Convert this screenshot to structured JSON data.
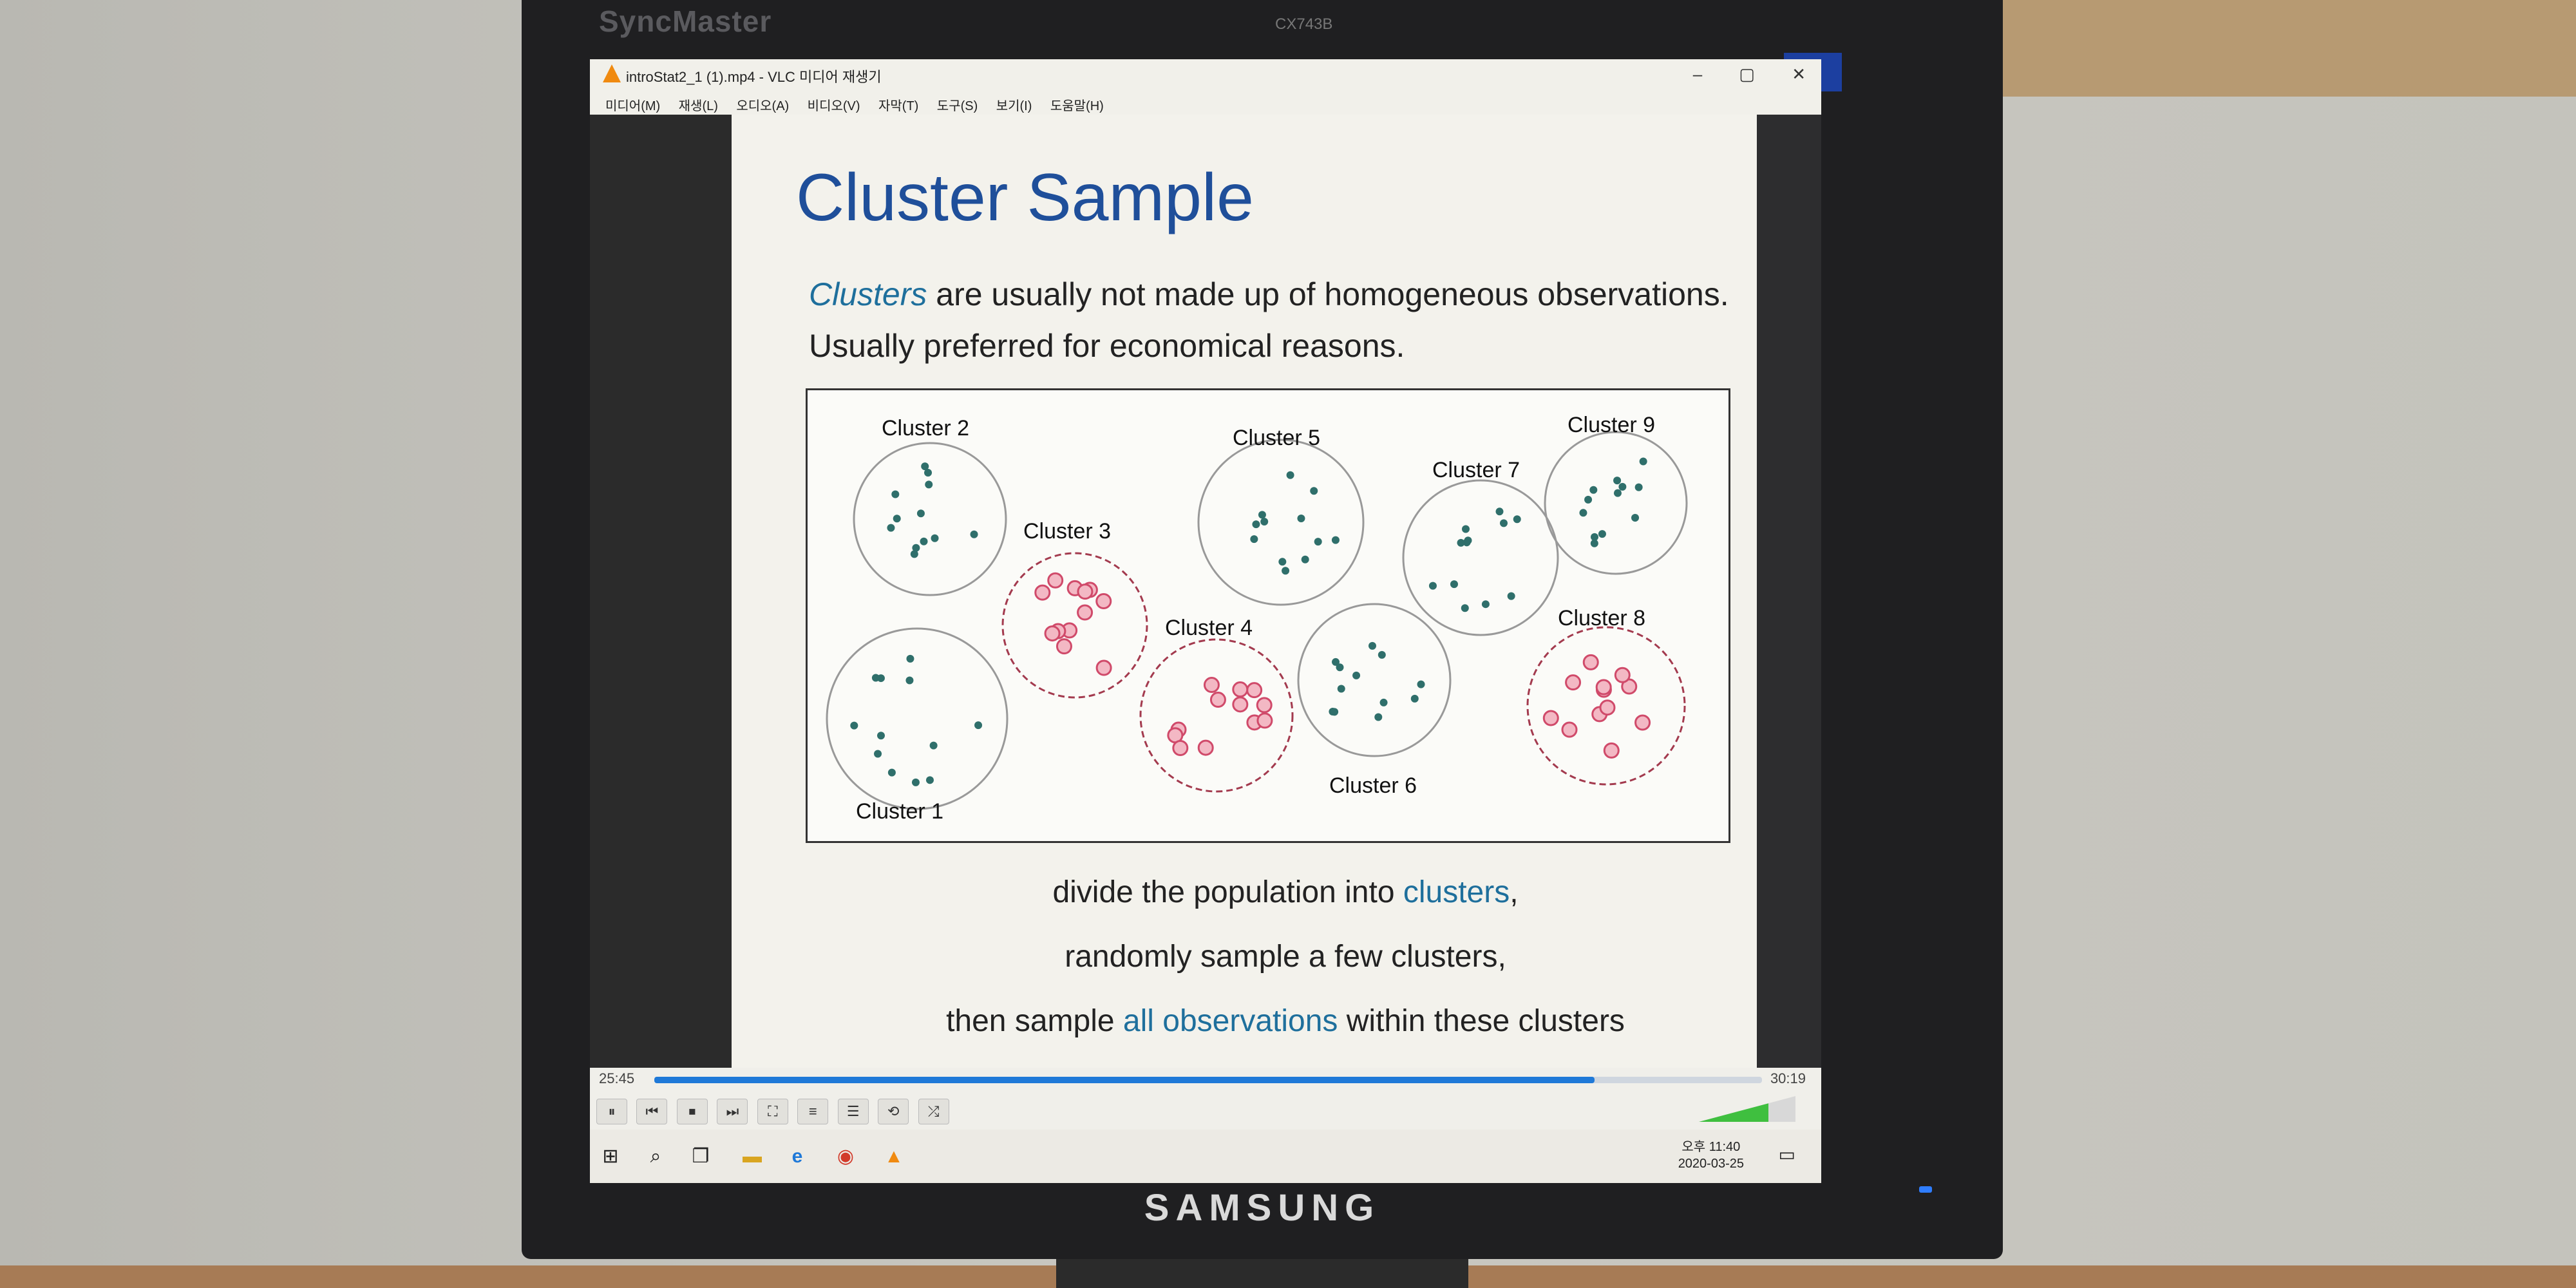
{
  "bezel": {
    "brand": "SyncMaster",
    "model": "CX743B",
    "manufacturer": "SAMSUNG"
  },
  "window": {
    "title": "introStat2_1 (1).mp4 - VLC 미디어 재생기",
    "menu": [
      "미디어(M)",
      "재생(L)",
      "오디오(A)",
      "비디오(V)",
      "자막(T)",
      "도구(S)",
      "보기(I)",
      "도움말(H)"
    ],
    "buttons": {
      "minimize": "–",
      "maximize": "▢",
      "close": "✕"
    }
  },
  "slide": {
    "title": "Cluster Sample",
    "line1_accent": "Clusters",
    "line1_rest": " are usually not made up of homogeneous observations.",
    "line2": "Usually preferred for economical reasons.",
    "caption1_pre": "divide the population into ",
    "caption1_accent": "clusters",
    "caption1_post": ",",
    "caption2": "randomly sample a few clusters,",
    "caption3_pre": "then sample ",
    "caption3_accent": "all observations",
    "caption3_post": " within these clusters",
    "clusters": [
      {
        "label": "Cluster 1",
        "sampled": false
      },
      {
        "label": "Cluster 2",
        "sampled": false
      },
      {
        "label": "Cluster 3",
        "sampled": true
      },
      {
        "label": "Cluster 4",
        "sampled": true
      },
      {
        "label": "Cluster 5",
        "sampled": false
      },
      {
        "label": "Cluster 6",
        "sampled": false
      },
      {
        "label": "Cluster 7",
        "sampled": false
      },
      {
        "label": "Cluster 8",
        "sampled": true
      },
      {
        "label": "Cluster 9",
        "sampled": false
      }
    ]
  },
  "player": {
    "elapsed": "25:45",
    "duration": "30:19",
    "progress": 0.849,
    "volume": 0.72,
    "buttons": [
      "⏸",
      "⏮",
      "⏹",
      "⏭",
      "⛶",
      "≡",
      "☰",
      "⟲",
      "⤮"
    ]
  },
  "taskbar": {
    "apps": [
      "start-icon",
      "search-icon",
      "task-view-icon",
      "file-explorer-icon",
      "edge-icon",
      "chrome-icon",
      "vlc-icon"
    ],
    "time": "오후 11:40",
    "date": "2020-03-25"
  },
  "colors": {
    "slide_title": "#1f4f9a",
    "accent": "#1e6f9c",
    "dot": "#2f6f6b",
    "sampled_dot": "#d04a6a",
    "progress": "#1f79d8"
  }
}
